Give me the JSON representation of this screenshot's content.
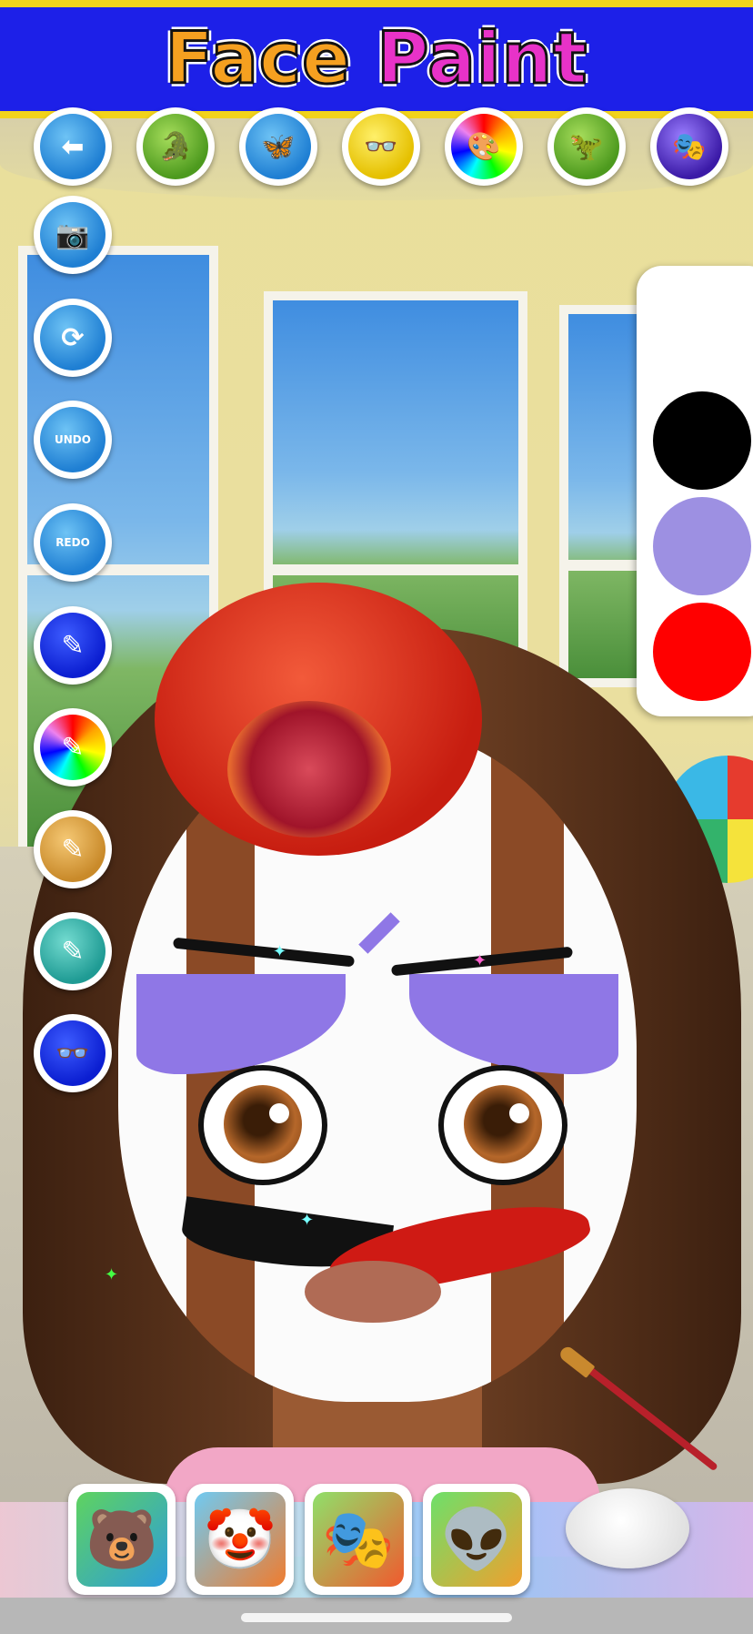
{
  "header": {
    "title_part1": "Face ",
    "title_part2": "Paint"
  },
  "top_toolbar": [
    {
      "name": "back-button",
      "icon": "arrow-left-icon",
      "glyph": "⬅"
    },
    {
      "name": "crocodile-category",
      "icon": "crocodile-icon",
      "glyph": "🐊"
    },
    {
      "name": "butterfly-category",
      "icon": "butterfly-icon",
      "glyph": "🦋"
    },
    {
      "name": "glasses-category",
      "icon": "glasses-icon",
      "glyph": "👓"
    },
    {
      "name": "palette-category",
      "icon": "paint-palette-icon",
      "glyph": "🎨"
    },
    {
      "name": "dinosaur-category",
      "icon": "dinosaur-icon",
      "glyph": "🦖"
    },
    {
      "name": "mask-category",
      "icon": "mask-icon",
      "glyph": "🎭"
    }
  ],
  "side_toolbar": {
    "camera": {
      "glyph": "📷"
    },
    "reset": {
      "glyph": "⟳"
    },
    "undo_label": "UNDO",
    "redo_label": "REDO",
    "brush_glyph": "✎",
    "eyewear_glyph": "👓"
  },
  "palette": {
    "colors": [
      "#ffffff",
      "#000000",
      "#9d90e2",
      "#ff0000"
    ]
  },
  "templates": [
    {
      "name": "template-bear",
      "icon": "bear-face-icon",
      "glyph": "🐻"
    },
    {
      "name": "template-clown",
      "icon": "clown-face-icon",
      "glyph": "🤡"
    },
    {
      "name": "template-mask",
      "icon": "mask-face-icon",
      "glyph": "🎭"
    },
    {
      "name": "template-alien",
      "icon": "blue-face-icon",
      "glyph": "👽"
    }
  ]
}
